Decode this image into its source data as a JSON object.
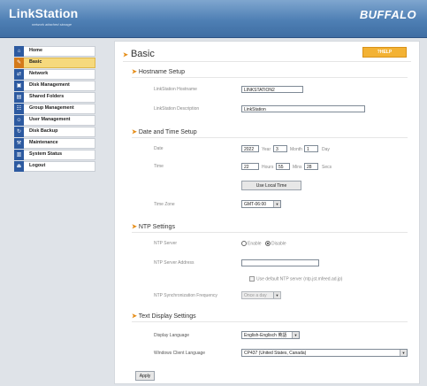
{
  "header": {
    "logo": "LinkStation",
    "logo_tagline": "network attached storage",
    "brand": "BUFFALO"
  },
  "sidebar": {
    "items": [
      {
        "label": "Home",
        "icon": "house-icon",
        "glyph": "⌂",
        "active": false
      },
      {
        "label": "Basic",
        "icon": "settings-icon",
        "glyph": "✎",
        "active": true
      },
      {
        "label": "Network",
        "icon": "network-icon",
        "glyph": "⇄",
        "active": false
      },
      {
        "label": "Disk Management",
        "icon": "disk-icon",
        "glyph": "▣",
        "active": false
      },
      {
        "label": "Shared Folders",
        "icon": "folder-icon",
        "glyph": "▤",
        "active": false
      },
      {
        "label": "Group Management",
        "icon": "group-icon",
        "glyph": "☷",
        "active": false
      },
      {
        "label": "User Management",
        "icon": "user-icon",
        "glyph": "☺",
        "active": false
      },
      {
        "label": "Disk Backup",
        "icon": "backup-icon",
        "glyph": "↻",
        "active": false
      },
      {
        "label": "Maintenance",
        "icon": "wrench-icon",
        "glyph": "⚒",
        "active": false
      },
      {
        "label": "System Status",
        "icon": "status-icon",
        "glyph": "▥",
        "active": false
      },
      {
        "label": "Logout",
        "icon": "logout-icon",
        "glyph": "⏏",
        "active": false
      }
    ]
  },
  "main": {
    "title": "Basic",
    "help_label": "?HELP",
    "hostname": {
      "section_title": "Hostname Setup",
      "name_label": "LinkStation Hostname",
      "name_value": "LINKSTATION2",
      "desc_label": "LinkStation Description",
      "desc_value": "LinkStation"
    },
    "datetime": {
      "section_title": "Date and Time Setup",
      "date_label": "Date",
      "year": "2022",
      "year_label": "Year",
      "month": "3",
      "month_label": "Month",
      "day": "1",
      "day_label": "Day",
      "time_label": "Time",
      "hours": "22",
      "hours_label": "Hours",
      "mins": "55",
      "mins_label": "Mins",
      "secs": "28",
      "secs_label": "Secs",
      "local_time_button": "Use Local Time",
      "timezone_label": "Time Zone",
      "timezone_value": "GMT-06:00"
    },
    "ntp": {
      "section_title": "NTP Settings",
      "server_label": "NTP Server",
      "enable_label": "Enable",
      "disable_label": "Disable",
      "selected": "Disable",
      "address_label": "NTP Server Address",
      "address_value": "",
      "default_checkbox_label": "Use default NTP server (ntp.jst.mfeed.ad.jp)",
      "freq_label": "NTP Synchronization Frequency",
      "freq_value": "Once a day"
    },
    "display": {
      "section_title": "Text Display Settings",
      "lang_label": "Display Language",
      "lang_value": "English-Englisch 英語",
      "client_label": "Windows Client Language",
      "client_value": "CP437 (United States, Canada)"
    },
    "apply_label": "Apply"
  }
}
